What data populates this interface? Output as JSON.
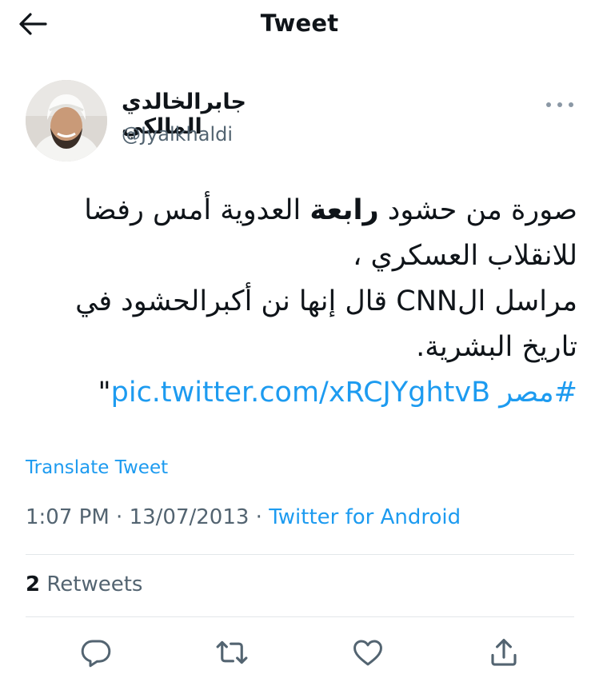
{
  "header": {
    "title": "Tweet",
    "back_icon": "arrow-left-icon"
  },
  "author": {
    "display_name": "جابرالخالدي المالكي",
    "handle": "@Jyalkhaldi",
    "more_icon": "more-horizontal-icon"
  },
  "tweet": {
    "line1_a": "صورة من حشود ",
    "line1_bold": "رابعة",
    "line1_b": " العدوية أمس رفضا",
    "line2": "للانقلاب العسكري ،",
    "line3": "مراسل الCNN قال إنها نن أكبرالحشود في",
    "line4": "تاريخ البشرية.",
    "hashtag": "#مصر",
    "link": "pic.twitter.com/xRCJYghtvB",
    "quote": "\""
  },
  "translate_label": "Translate Tweet",
  "meta": {
    "time": "1:07 PM",
    "sep1": " · ",
    "date": "13/07/2013",
    "sep2": " · ",
    "source": "Twitter for Android"
  },
  "stats": {
    "retweet_count": "2",
    "retweet_label": " Retweets"
  },
  "actions": [
    "reply-icon",
    "retweet-icon",
    "like-icon",
    "share-icon"
  ],
  "colors": {
    "accent": "#1d9bf0",
    "text": "#0f1419",
    "muted": "#536471",
    "divider": "#e3e7ea"
  }
}
